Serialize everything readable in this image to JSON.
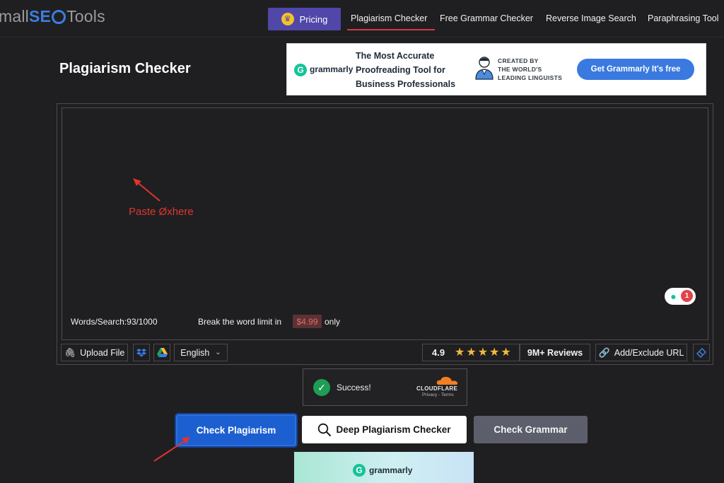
{
  "nav": {
    "logo_prefix": "mall",
    "logo_seo": "SE",
    "logo_suffix": "Tools",
    "pricing": "Pricing",
    "links": [
      "Plagiarism Checker",
      "Free Grammar Checker",
      "Reverse Image Search",
      "Paraphrasing Tool"
    ]
  },
  "page": {
    "title": "Plagiarism Checker"
  },
  "ad": {
    "brand": "grammarly",
    "headline": "The Most Accurate Proofreading Tool for Business Professionals",
    "created_line1": "CREATED BY",
    "created_line2": "THE WORLD'S",
    "created_line3": "LEADING LINGUISTS",
    "cta": "Get Grammarly It's free"
  },
  "editor": {
    "annotation": "Paste Øxhere",
    "words_search": "Words/Search:93/1000",
    "limit_text": "Break the word limit in",
    "price": "$4.99",
    "only": "only",
    "badge_count": "1"
  },
  "toolbar": {
    "upload": "Upload File",
    "language": "English",
    "rating": "4.9",
    "stars": "★★★★★",
    "reviews": "9M+ Reviews",
    "add_exclude": "Add/Exclude URL"
  },
  "captcha": {
    "status": "Success!",
    "brand": "CLOUDFLARE",
    "links": "Privacy - Terms"
  },
  "actions": {
    "check_plagiarism": "Check Plagiarism",
    "deep_check": "Deep Plagiarism Checker",
    "check_grammar": "Check Grammar"
  },
  "bottom_ad": {
    "brand": "grammarly"
  },
  "colors": {
    "accent": "#1c5fd1",
    "pricing": "#5147a8",
    "alert": "#e0342e",
    "brand_green": "#15c39a"
  },
  "icons": [
    "crown-icon",
    "paperclip-icon",
    "dropbox-icon",
    "google-drive-icon",
    "chevron-down-icon",
    "star-icon",
    "link-icon",
    "eraser-icon",
    "check-icon",
    "magnifier-icon",
    "lightbulb-icon"
  ]
}
